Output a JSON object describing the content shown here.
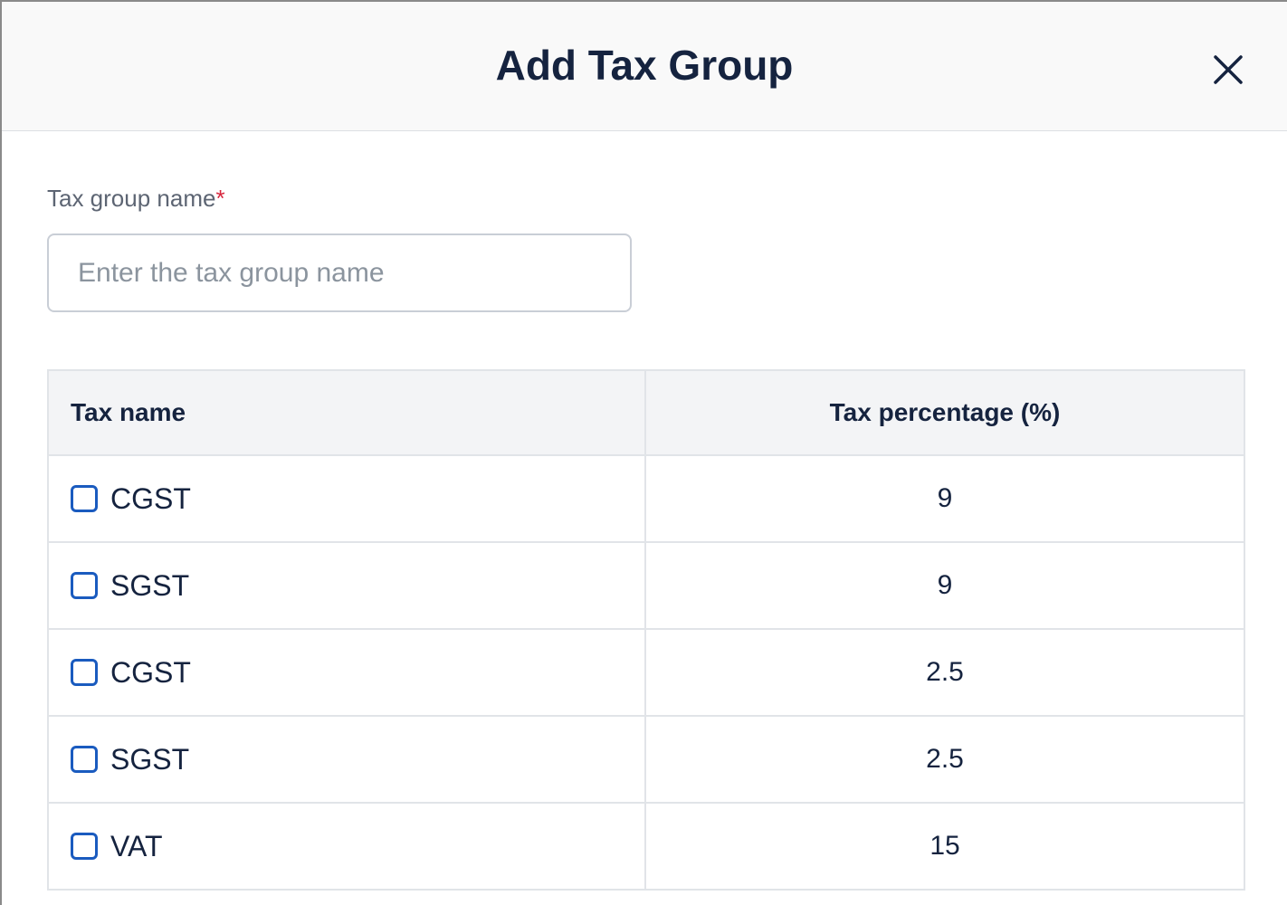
{
  "dialog": {
    "title": "Add Tax Group",
    "close_icon": "close-icon"
  },
  "form": {
    "name_label": "Tax group name",
    "required_marker": "*",
    "name_placeholder": "Enter the tax group name",
    "name_value": ""
  },
  "table": {
    "headers": {
      "tax_name": "Tax name",
      "tax_percentage": "Tax percentage (%)"
    },
    "rows": [
      {
        "name": "CGST",
        "percentage": "9",
        "checked": false
      },
      {
        "name": "SGST",
        "percentage": "9",
        "checked": false
      },
      {
        "name": "CGST",
        "percentage": "2.5",
        "checked": false
      },
      {
        "name": "SGST",
        "percentage": "2.5",
        "checked": false
      },
      {
        "name": "VAT",
        "percentage": "15",
        "checked": false
      }
    ]
  },
  "colors": {
    "title": "#15233f",
    "checkbox_border": "#1a5bbf",
    "required": "#d7263d",
    "header_bg": "#f9f9f9",
    "table_header_bg": "#f3f4f6"
  }
}
